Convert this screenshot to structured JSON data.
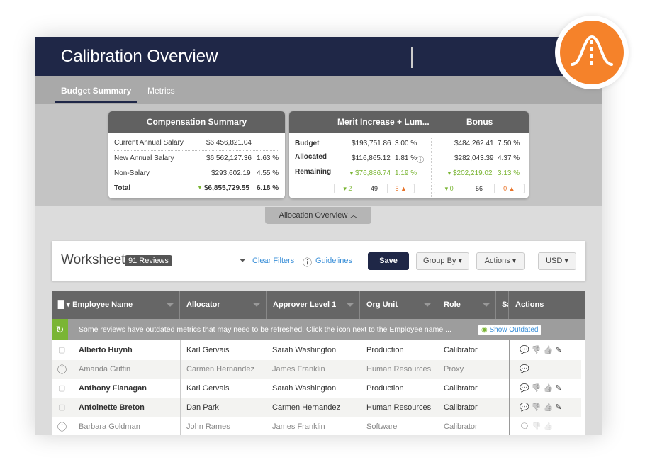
{
  "header": {
    "title": "Calibration Overview"
  },
  "logo": {
    "icon": "bell-curve-icon",
    "color": "#f5822a"
  },
  "tabs": [
    {
      "label": "Budget Summary",
      "active": true
    },
    {
      "label": "Metrics",
      "active": false
    }
  ],
  "comp_summary": {
    "title": "Compensation Summary",
    "rows": [
      {
        "label": "Current Annual Salary",
        "value": "$6,456,821.04",
        "pct": ""
      },
      {
        "label": "New Annual Salary",
        "value": "$6,562,127.36",
        "pct": "1.63 %"
      },
      {
        "label": "Non-Salary",
        "value": "$293,602.19",
        "pct": "4.55 %"
      },
      {
        "label": "Total",
        "value": "$6,855,729.55",
        "pct": "6.18 %"
      }
    ]
  },
  "merit": {
    "title": "Merit Increase + Lum...",
    "bonus_title": "Bonus",
    "labels": [
      "Budget",
      "Allocated",
      "Remaining"
    ],
    "merit_rows": [
      {
        "value": "$193,751.86",
        "pct": "3.00 %"
      },
      {
        "value": "$116,865.12",
        "pct": "1.81 %"
      },
      {
        "value": "$76,886.74",
        "pct": "1.19 %"
      }
    ],
    "bonus_rows": [
      {
        "value": "$484,262.41",
        "pct": "7.50 %"
      },
      {
        "value": "$282,043.39",
        "pct": "4.37 %"
      },
      {
        "value": "$202,219.02",
        "pct": "3.13 %"
      }
    ],
    "merit_counts": [
      "2",
      "49",
      "5"
    ],
    "bonus_counts": [
      "0",
      "56",
      "0"
    ]
  },
  "allocation_overview": "Allocation Overview",
  "worksheet": {
    "title": "Worksheet",
    "badge": "91 Reviews",
    "clear_filters": "Clear Filters",
    "guidelines": "Guidelines",
    "save": "Save",
    "group_by": "Group By",
    "actions": "Actions",
    "currency": "USD"
  },
  "table": {
    "columns": [
      "Employee Name",
      "Allocator",
      "Approver Level 1",
      "Org Unit",
      "Role",
      "Sa",
      "Actions"
    ],
    "banner": "Some reviews have outdated metrics that may need to be refreshed. Click the icon next to the Employee name ...",
    "show_outdated": "Show Outdated",
    "rows": [
      {
        "name": "Alberto Huynh",
        "allocator": "Karl Gervais",
        "approver": "Sarah Washington",
        "org": "Production",
        "role": "Calibrator"
      },
      {
        "name": "Amanda Griffin",
        "allocator": "Carmen Hernandez",
        "approver": "James Franklin",
        "org": "Human Resources",
        "role": "Proxy"
      },
      {
        "name": "Anthony Flanagan",
        "allocator": "Karl Gervais",
        "approver": "Sarah Washington",
        "org": "Production",
        "role": "Calibrator"
      },
      {
        "name": "Antoinette Breton",
        "allocator": "Dan Park",
        "approver": "Carmen Hernandez",
        "org": "Human Resources",
        "role": "Calibrator"
      },
      {
        "name": "Barbara Goldman",
        "allocator": "John Rames",
        "approver": "James Franklin",
        "org": "Software",
        "role": "Calibrator"
      }
    ]
  }
}
